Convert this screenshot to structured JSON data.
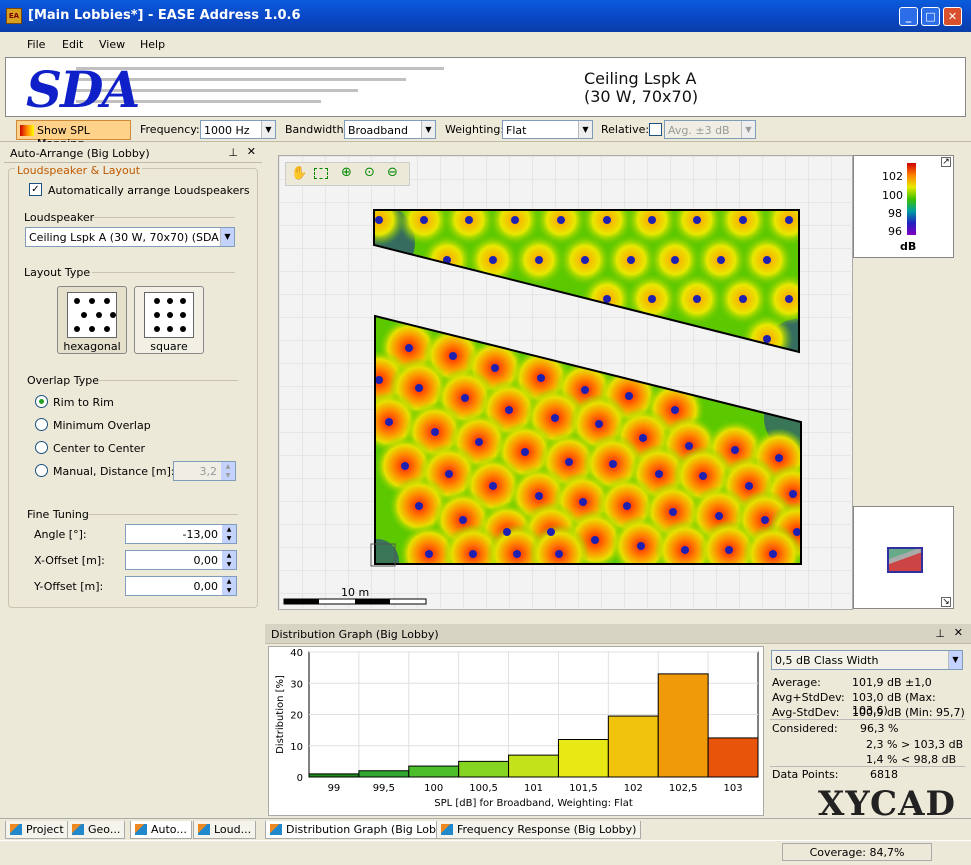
{
  "window": {
    "title": "[Main Lobbies*] - EASE Address 1.0.6"
  },
  "menu": [
    "File",
    "Edit",
    "View",
    "Help"
  ],
  "banner": {
    "logo": "SDA",
    "speaker_line1": "Ceiling Lspk A",
    "speaker_line2": "(30 W, 70x70)"
  },
  "toolbar": {
    "show_spl": "Show SPL Mapping",
    "frequency_label": "Frequency:",
    "frequency_value": "1000 Hz",
    "bandwidth_label": "Bandwidth:",
    "bandwidth_value": "Broadband",
    "weighting_label": "Weighting:",
    "weighting_value": "Flat",
    "relative_label": "Relative:",
    "relative_value": "Avg. ±3 dB"
  },
  "left_panel": {
    "title": "Auto-Arrange (Big Lobby)",
    "group_title": "Loudspeaker & Layout",
    "auto_arrange": "Automatically arrange Loudspeakers",
    "loudspeaker_label": "Loudspeaker",
    "loudspeaker_value": "Ceiling Lspk A (30 W, 70x70) (SDA)",
    "layout_type_label": "Layout Type",
    "layout_hex": "hexagonal",
    "layout_square": "square",
    "overlap_label": "Overlap Type",
    "overlap_options": [
      "Rim to Rim",
      "Minimum Overlap",
      "Center to Center",
      "Manual, Distance [m]:"
    ],
    "manual_distance": "3,2",
    "fine_tuning_label": "Fine Tuning",
    "angle_label": "Angle [°]:",
    "angle_value": "-13,00",
    "xoffset_label": "X-Offset [m]:",
    "xoffset_value": "0,00",
    "yoffset_label": "Y-Offset [m]:",
    "yoffset_value": "0,00"
  },
  "map": {
    "scale_label": "10 m",
    "legend_ticks": [
      "102",
      "100",
      "98",
      "96"
    ],
    "legend_unit": "dB"
  },
  "distribution": {
    "title": "Distribution Graph (Big Lobby)",
    "class_width": "0,5 dB Class Width",
    "stats": {
      "average_label": "Average:",
      "average": "101,9 dB ±1,0",
      "plus_label": "Avg+StdDev:",
      "plus": "103,0 dB (Max: 103,6)",
      "minus_label": "Avg-StdDev:",
      "minus": "100,9 dB (Min: 95,7)",
      "considered_label": "Considered:",
      "considered": "96,3 %",
      "above": "2,3 % > 103,3 dB",
      "below": "1,4 % < 98,8 dB",
      "points_label": "Data Points:",
      "points": "6818"
    }
  },
  "chart_data": {
    "type": "bar",
    "categories": [
      "99",
      "99,5",
      "100",
      "100,5",
      "101",
      "101,5",
      "102",
      "102,5",
      "103"
    ],
    "values": [
      1,
      2,
      3.5,
      5,
      7,
      12,
      19.5,
      33,
      12.5
    ],
    "colors": [
      "#1e8a1e",
      "#2fa62f",
      "#4cbe2a",
      "#86d422",
      "#c4e21a",
      "#e8e814",
      "#f0c40c",
      "#f09a0a",
      "#e8540a"
    ],
    "xlabel": "SPL [dB] for Broadband, Weighting: Flat",
    "ylabel": "Distribution [%]",
    "ylim": [
      0,
      40
    ],
    "yticks": [
      "0",
      "10",
      "20",
      "30",
      "40"
    ]
  },
  "bottom_tabs": [
    "Project",
    "Geo...",
    "Auto...",
    "Loud...",
    "Distribution Graph (Big Lobby)",
    "Frequency Response (Big Lobby)"
  ],
  "status": {
    "coverage": "Coverage: 84,7%"
  },
  "watermark": "XYCAD"
}
